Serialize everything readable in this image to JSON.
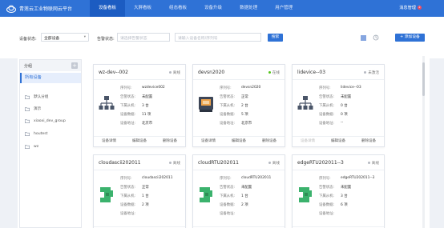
{
  "header": {
    "brand": "青莲云工业物联网云平台",
    "nav": [
      "设备看板",
      "大屏看板",
      "组态看板",
      "设备升级",
      "数据处理",
      "用户管理"
    ],
    "active_index": 0,
    "user": "消息管理",
    "badge": "2"
  },
  "filters": {
    "status_label": "设备状态:",
    "status_value": "全部设备",
    "alarm_label": "告警状态:",
    "alarm_placeholder": "请选择告警状态",
    "search_placeholder": "请输入设备名称/序列号",
    "search_button": "搜索",
    "add_button": "+ 添加设备"
  },
  "sidebar": {
    "title": "分组",
    "all": "所有设备",
    "groups": [
      "默认分组",
      "演示",
      "xiaoxi_dev_group",
      "houtest",
      "wz"
    ]
  },
  "field_labels": [
    "序列号:",
    "告警状态:",
    "下属从机:",
    "设备数据:",
    "设备地址:"
  ],
  "actions": [
    "设备详情",
    "编辑设备",
    "删除设备"
  ],
  "devices": [
    {
      "name": "wz-dev--002",
      "status": "离线",
      "icon": "network-topology-icon",
      "fields": [
        "wzdevice002",
        "未配置",
        "3 台",
        "11 项",
        "北京市"
      ],
      "detail_enabled": true
    },
    {
      "name": "devsn2020",
      "status": "在线",
      "icon": "industrial-machine-icon",
      "fields": [
        "devsn2020",
        "正常",
        "2 台",
        "5 项",
        "北京市"
      ],
      "detail_enabled": true
    },
    {
      "name": "lidevice--03",
      "status": "未激活",
      "icon": "network-topology-icon",
      "fields": [
        "lidevice--03",
        "未配置",
        "0 台",
        "0 项",
        "--"
      ],
      "detail_enabled": false
    },
    {
      "name": "cloudascii202011",
      "status": "离线",
      "icon": "edge-gateway-icon",
      "fields": [
        "cloudascii202011",
        "正常",
        "1 台",
        "2 项",
        ""
      ],
      "detail_enabled": true
    },
    {
      "name": "cloudRTU202011",
      "status": "离线",
      "icon": "edge-gateway-icon",
      "fields": [
        "cloudRTU202011",
        "未配置",
        "1 台",
        "2 项",
        ""
      ],
      "detail_enabled": true
    },
    {
      "name": "edgeRTU202011--3",
      "status": "离线",
      "icon": "edge-gateway-icon",
      "fields": [
        "edgeRTU202011--3",
        "未配置",
        "3 台",
        "6 项",
        ""
      ],
      "detail_enabled": true
    }
  ],
  "colors": {
    "primary": "#2f72d6",
    "nav_active": "#1c5cc2",
    "online": "#52c41a",
    "offline": "#b5b9c2",
    "icon_green": "#3bb26d",
    "icon_dark": "#4a5568"
  }
}
